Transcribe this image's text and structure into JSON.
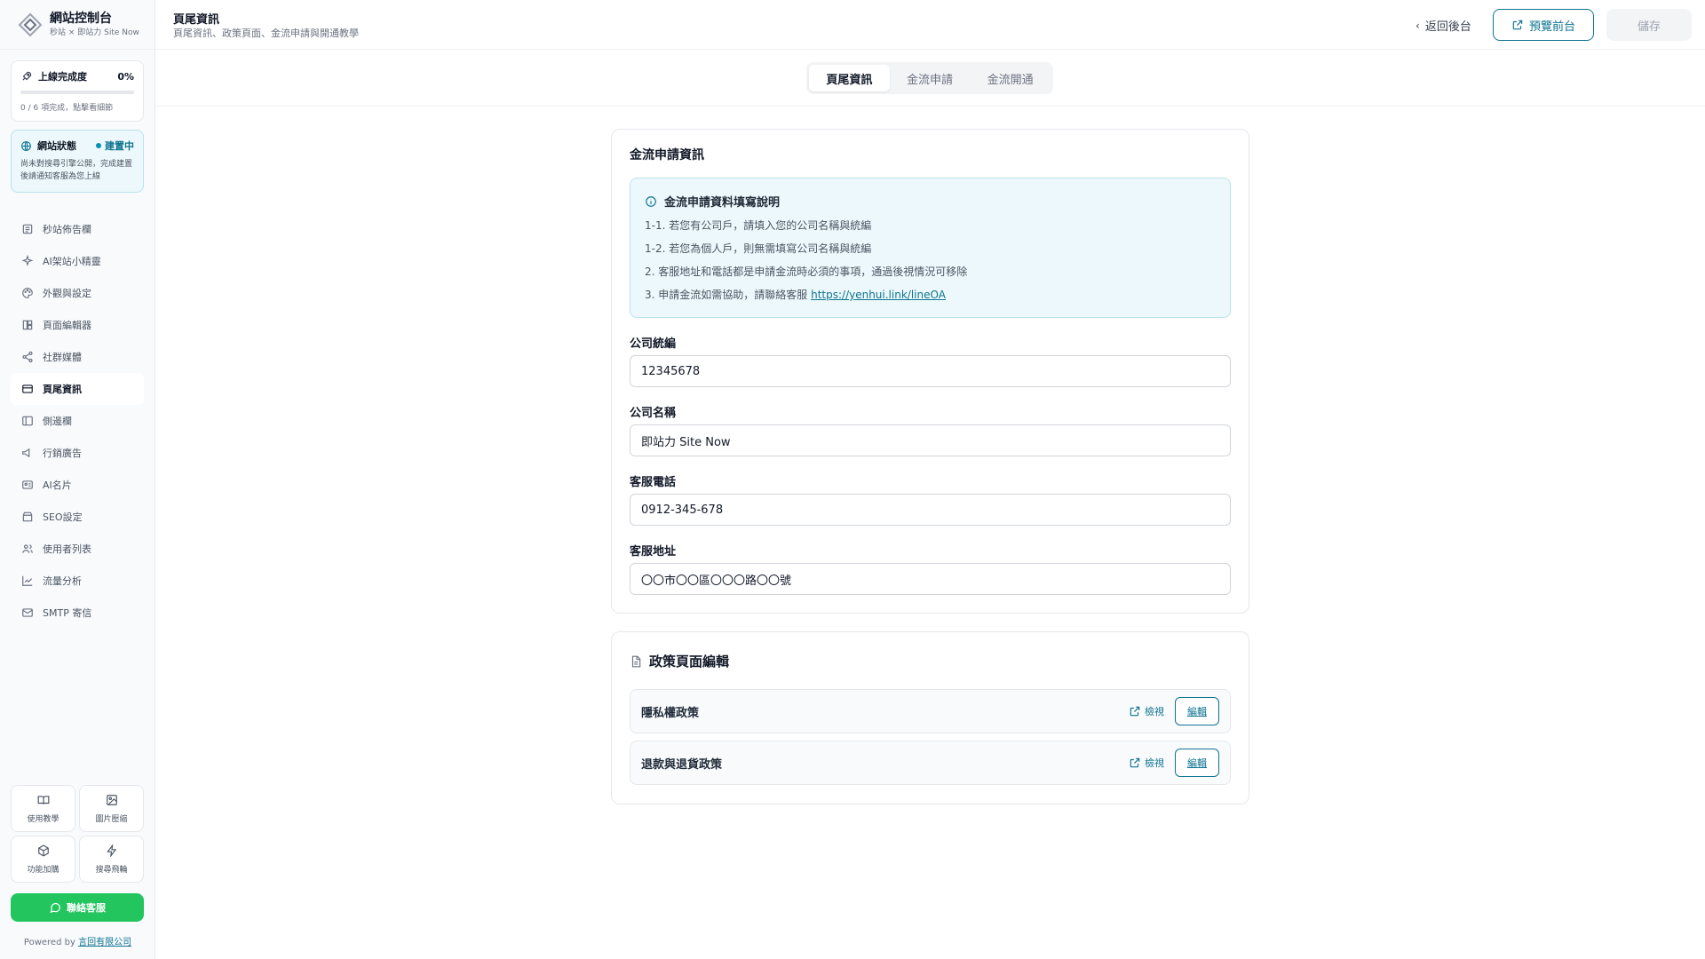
{
  "brand": {
    "title": "網站控制台",
    "subtitle": "秒站 × 即站力 Site Now"
  },
  "progress": {
    "label": "上線完成度",
    "percent_text": "0%",
    "fraction": 0.0,
    "note": "0 / 6 項完成，點擊看細節"
  },
  "site_status": {
    "label": "網站狀態",
    "badge": "建置中",
    "description": "尚未對搜尋引擎公開，完成建置後請通知客服為您上線"
  },
  "sidebar": {
    "items": [
      {
        "label": "秒站佈告欄",
        "icon": "bulletin-icon"
      },
      {
        "label": "AI架站小精靈",
        "icon": "sparkle-icon"
      },
      {
        "label": "外觀與設定",
        "icon": "palette-icon"
      },
      {
        "label": "頁面編輯器",
        "icon": "layout-icon"
      },
      {
        "label": "社群媒體",
        "icon": "share-icon"
      },
      {
        "label": "頁尾資訊",
        "icon": "card-icon",
        "active": true
      },
      {
        "label": "側邊欄",
        "icon": "sidebar-icon"
      },
      {
        "label": "行銷廣告",
        "icon": "megaphone-icon"
      },
      {
        "label": "AI名片",
        "icon": "id-card-icon"
      },
      {
        "label": "SEO設定",
        "icon": "store-icon"
      },
      {
        "label": "使用者列表",
        "icon": "users-icon"
      },
      {
        "label": "流量分析",
        "icon": "chart-icon"
      },
      {
        "label": "SMTP 寄信",
        "icon": "mail-icon"
      }
    ],
    "tools": [
      {
        "label": "使用教學",
        "icon": "book-icon"
      },
      {
        "label": "圖片壓縮",
        "icon": "image-icon"
      },
      {
        "label": "功能加購",
        "icon": "box-icon"
      },
      {
        "label": "搜尋飛輪",
        "icon": "bolt-icon"
      }
    ],
    "contact_label": "聯絡客服",
    "powered_prefix": "Powered by",
    "powered_link": "言回有限公司"
  },
  "header": {
    "title": "頁尾資訊",
    "subtitle": "頁尾資訊、政策頁面、金流申請與開通教學",
    "back_label": "返回後台",
    "preview_label": "預覽前台",
    "save_label": "儲存"
  },
  "tabs": [
    {
      "label": "頁尾資訊",
      "active": true
    },
    {
      "label": "金流申請",
      "active": false
    },
    {
      "label": "金流開通",
      "active": false
    }
  ],
  "payment_card": {
    "title": "金流申請資訊",
    "info": {
      "title": "金流申請資料填寫說明",
      "line1": "1-1. 若您有公司戶，請填入您的公司名稱與統編",
      "line2": "1-2. 若您為個人戶，則無需填寫公司名稱與統編",
      "line3": "2. 客服地址和電話都是申請金流時必須的事項，通過後視情況可移除",
      "line4_prefix": "3. 申請金流如需協助，請聯絡客服",
      "line4_link": "https://yenhui.link/lineOA"
    },
    "fields": {
      "tax_id": {
        "label": "公司統編",
        "value": "12345678"
      },
      "company_name": {
        "label": "公司名稱",
        "value": "即站力 Site Now"
      },
      "phone": {
        "label": "客服電話",
        "value": "0912-345-678"
      },
      "address": {
        "label": "客服地址",
        "value": "〇〇市〇〇區〇〇〇路〇〇號"
      }
    }
  },
  "policy_card": {
    "title": "政策頁面編輯",
    "view_label": "檢視",
    "edit_label": "編輯",
    "policies": [
      {
        "name": "隱私權政策"
      },
      {
        "name": "退款與退貨政策"
      }
    ]
  },
  "colors": {
    "accent": "#0e7490",
    "success": "#22c55e",
    "info_bg": "#ecf8fb"
  }
}
